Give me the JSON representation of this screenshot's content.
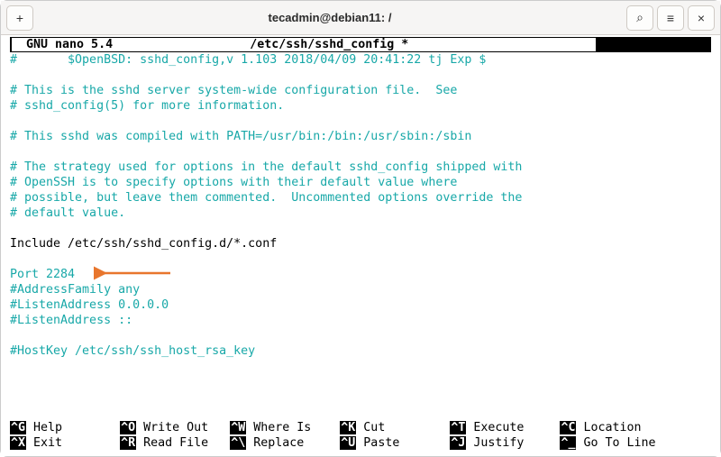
{
  "window": {
    "title": "tecadmin@debian11: /"
  },
  "titlebar": {
    "newtab_icon": "+",
    "search_icon": "⌕",
    "menu_icon": "≡",
    "close_icon": "×"
  },
  "nano": {
    "app_label": "  GNU nano 5.4",
    "file_label": "/etc/ssh/sshd_config *"
  },
  "file": {
    "lines": [
      {
        "cls": "cyan",
        "text": "#       $OpenBSD: sshd_config,v 1.103 2018/04/09 20:41:22 tj Exp $"
      },
      {
        "cls": "",
        "text": ""
      },
      {
        "cls": "cyan",
        "text": "# This is the sshd server system-wide configuration file.  See"
      },
      {
        "cls": "cyan",
        "text": "# sshd_config(5) for more information."
      },
      {
        "cls": "",
        "text": ""
      },
      {
        "cls": "cyan",
        "text": "# This sshd was compiled with PATH=/usr/bin:/bin:/usr/sbin:/sbin"
      },
      {
        "cls": "",
        "text": ""
      },
      {
        "cls": "cyan",
        "text": "# The strategy used for options in the default sshd_config shipped with"
      },
      {
        "cls": "cyan",
        "text": "# OpenSSH is to specify options with their default value where"
      },
      {
        "cls": "cyan",
        "text": "# possible, but leave them commented.  Uncommented options override the"
      },
      {
        "cls": "cyan",
        "text": "# default value."
      },
      {
        "cls": "",
        "text": ""
      },
      {
        "cls": "",
        "text": "Include /etc/ssh/sshd_config.d/*.conf"
      },
      {
        "cls": "",
        "text": ""
      },
      {
        "cls": "cyan",
        "text": "Port 2284"
      },
      {
        "cls": "cyan",
        "text": "#AddressFamily any"
      },
      {
        "cls": "cyan",
        "text": "#ListenAddress 0.0.0.0"
      },
      {
        "cls": "cyan",
        "text": "#ListenAddress ::"
      },
      {
        "cls": "",
        "text": ""
      },
      {
        "cls": "cyan",
        "text": "#HostKey /etc/ssh/ssh_host_rsa_key"
      }
    ]
  },
  "shortcuts": {
    "row1": [
      {
        "key": "^G",
        "label": "Help"
      },
      {
        "key": "^O",
        "label": "Write Out"
      },
      {
        "key": "^W",
        "label": "Where Is"
      },
      {
        "key": "^K",
        "label": "Cut"
      },
      {
        "key": "^T",
        "label": "Execute"
      },
      {
        "key": "^C",
        "label": "Location"
      }
    ],
    "row2": [
      {
        "key": "^X",
        "label": "Exit"
      },
      {
        "key": "^R",
        "label": "Read File"
      },
      {
        "key": "^\\",
        "label": "Replace"
      },
      {
        "key": "^U",
        "label": "Paste"
      },
      {
        "key": "^J",
        "label": "Justify"
      },
      {
        "key": "^_",
        "label": "Go To Line"
      }
    ]
  },
  "annotation": {
    "arrow_color": "#e8762d"
  }
}
